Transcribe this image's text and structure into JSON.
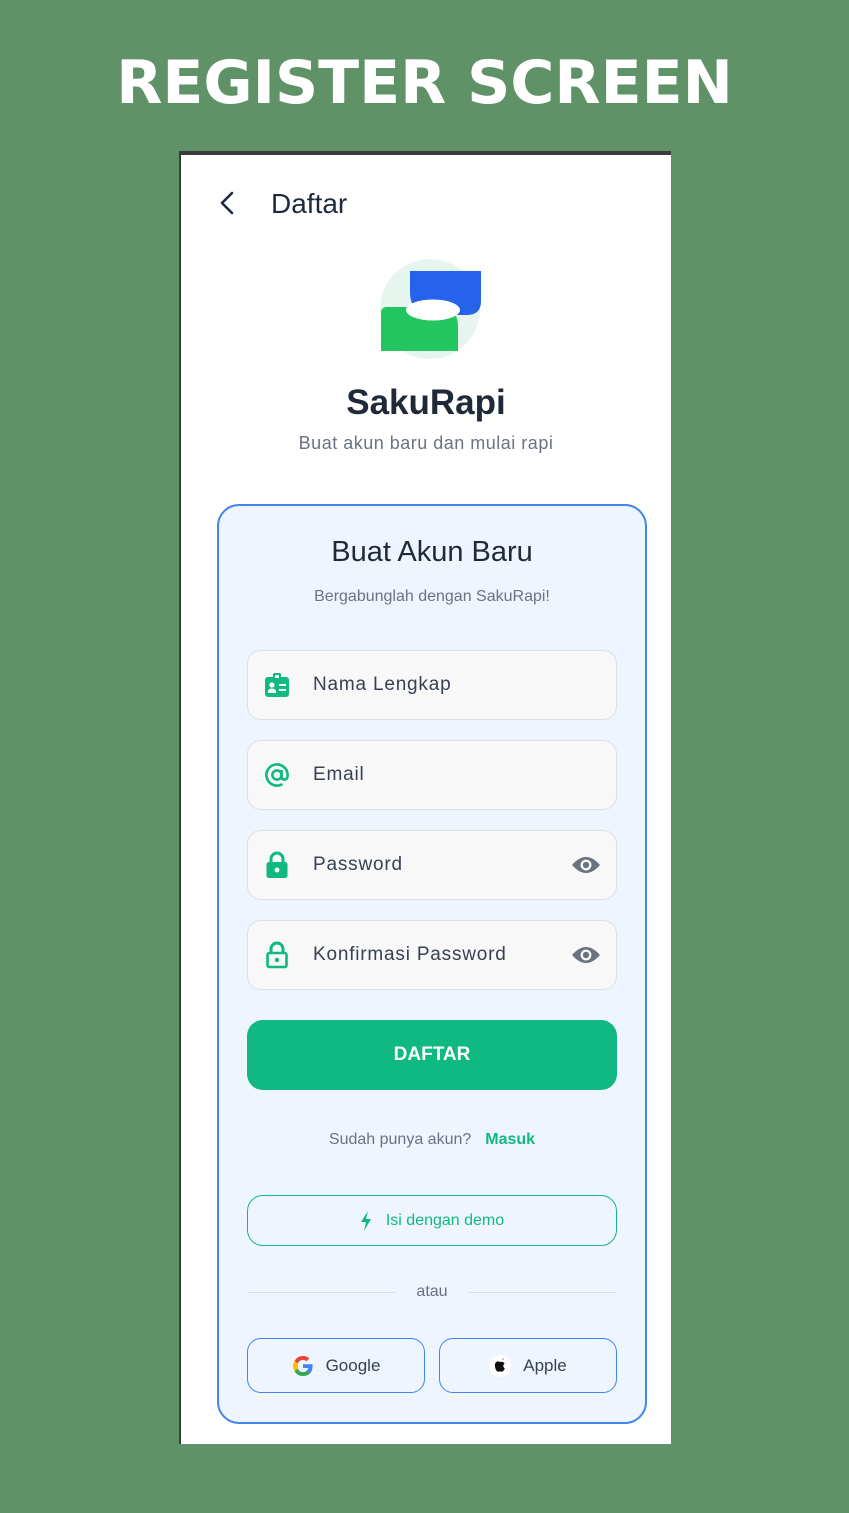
{
  "banner": {
    "title": "REGISTER SCREEN"
  },
  "appbar": {
    "title": "Daftar",
    "back_icon": "chevron-left-icon"
  },
  "brand": {
    "name": "SakuRapi",
    "tagline": "Buat akun baru dan mulai rapi",
    "logo_icon": "sakurapi-logo-icon"
  },
  "form": {
    "title": "Buat Akun Baru",
    "subtitle": "Bergabunglah dengan SakuRapi!",
    "fields": [
      {
        "placeholder": "Nama Lengkap",
        "icon": "id-badge-icon"
      },
      {
        "placeholder": "Email",
        "icon": "at-sign-icon"
      },
      {
        "placeholder": "Password",
        "icon": "lock-icon",
        "toggle_icon": "eye-icon"
      },
      {
        "placeholder": "Konfirmasi Password",
        "icon": "lock-outline-icon",
        "toggle_icon": "eye-icon"
      }
    ],
    "submit_label": "DAFTAR",
    "login_prompt": "Sudah punya akun?",
    "login_link": "Masuk",
    "demo_label": "Isi dengan demo",
    "divider_text": "atau",
    "social": [
      {
        "label": "Google",
        "icon": "google-icon"
      },
      {
        "label": "Apple",
        "icon": "apple-icon"
      }
    ]
  },
  "colors": {
    "background": "#5f9266",
    "accent_green": "#10b981",
    "accent_blue": "#3f86e8",
    "card_background": "#eff5fe"
  }
}
